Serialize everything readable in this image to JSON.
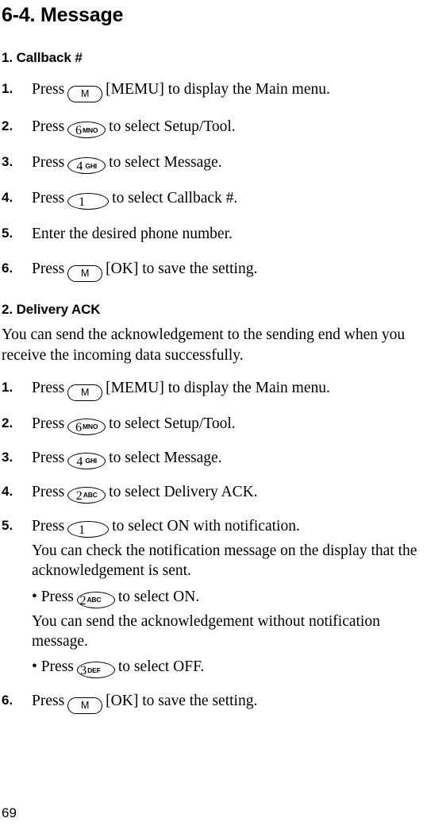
{
  "document": {
    "chapter_title": "6-4. Message",
    "page_number": "69"
  },
  "sections": [
    {
      "title": "1. Callback #",
      "steps": [
        {
          "number": "1.",
          "text_before": "Press",
          "key": {
            "type": "m",
            "label": "M"
          },
          "text_after": "[MEMU] to display the Main menu."
        },
        {
          "number": "2.",
          "text_before": "Press",
          "key": {
            "type": "num",
            "digit": "6",
            "letters": "MNO"
          },
          "text_after": "to select Setup/Tool."
        },
        {
          "number": "3.",
          "text_before": "Press",
          "key": {
            "type": "num",
            "digit": "4",
            "letters": "GHI",
            "spaced": true
          },
          "text_after": "to select Message."
        },
        {
          "number": "4.",
          "text_before": "Press",
          "key": {
            "type": "num",
            "digit": "1",
            "letters": "",
            "wide": true
          },
          "text_after": "to select Callback #."
        },
        {
          "number": "5.",
          "text_before": "Enter the desired phone number.",
          "key": null,
          "text_after": ""
        },
        {
          "number": "6.",
          "text_before": "Press",
          "key": {
            "type": "m",
            "label": "M"
          },
          "text_after": "[OK] to save the setting."
        }
      ]
    },
    {
      "title": "2. Delivery ACK",
      "intro": "You can send the acknowledgement to the sending end when you receive the incoming data successfully.",
      "steps": [
        {
          "number": "1.",
          "text_before": "Press",
          "key": {
            "type": "m",
            "label": "M"
          },
          "text_after": "[MEMU] to display the Main menu."
        },
        {
          "number": "2.",
          "text_before": "Press",
          "key": {
            "type": "num",
            "digit": "6",
            "letters": "MNO"
          },
          "text_after": "to select Setup/Tool."
        },
        {
          "number": "3.",
          "text_before": "Press",
          "key": {
            "type": "num",
            "digit": "4",
            "letters": "GHI",
            "spaced": true
          },
          "text_after": "to select Message."
        },
        {
          "number": "4.",
          "text_before": "Press",
          "key": {
            "type": "num",
            "digit": "2",
            "letters": "ABC"
          },
          "text_after": "to select Delivery ACK."
        },
        {
          "number": "5.",
          "text_before": "Press",
          "key": {
            "type": "num",
            "digit": "1",
            "letters": "",
            "wide": true
          },
          "text_after": "to select ON with notification.",
          "sub_content": {
            "para1": "You can check the notification message on the display that the acknowledgement is sent.",
            "bullet1": {
              "dot": "•",
              "text_before": "Press",
              "key": {
                "type": "num",
                "digit": "2",
                "letters": "ABC"
              },
              "text_after": "to select ON."
            },
            "para2": "You can send the acknowledgement without notification message.",
            "bullet2": {
              "dot": "•",
              "text_before": "Press",
              "key": {
                "type": "num",
                "digit": "3",
                "letters": "DEF"
              },
              "text_after": "to select OFF."
            }
          }
        },
        {
          "number": "6.",
          "text_before": "Press",
          "key": {
            "type": "m",
            "label": "M"
          },
          "text_after": "[OK] to save the setting."
        }
      ]
    }
  ]
}
